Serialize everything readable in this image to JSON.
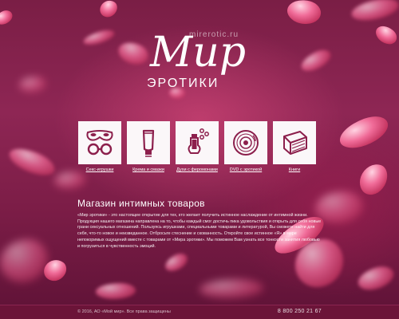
{
  "site": {
    "domain": "mirerotic.ru",
    "logo_main": "Мир",
    "logo_sub": "ЭРОТИКИ"
  },
  "categories": [
    {
      "label": "Секс-игрушки",
      "icon": "handcuffs-mask-icon"
    },
    {
      "label": "Крема и смазки",
      "icon": "cream-tube-icon"
    },
    {
      "label": "Духи с феромонами",
      "icon": "perfume-bottle-icon"
    },
    {
      "label": "DVD с эротикой",
      "icon": "dvd-disc-icon"
    },
    {
      "label": "Книги",
      "icon": "book-icon"
    }
  ],
  "main": {
    "title": "Магазин интимных товаров",
    "description": "«Мир эротики» - это настоящее открытие для тех, кто желает получить истинное наслаждение от интимной жизни. Продукция нашего магазина направлена на то, чтобы каждый смог достичь пика удовольствия и открыть для себя новые грани сексуальных отношений. Пользуясь игрушками, специальными товарами и литературой, Вы сможете найти для себя, что-то новое и неизведанное. Отбросьте стеснение и скованность. Откройте свое истинное «Я» в мире непокоримых ощущений вместе с товарами от «Мира эротики». Мы поможем Вам узнать все тонкости занятия любовью и погрузиться в чувственность эмоций."
  },
  "footer": {
    "copyright": "© 2016, АО «Мой мир». Все права защищены",
    "phone": "8 800 250 21 67"
  },
  "colors": {
    "background": "#8e2654",
    "footer": "#6b1438",
    "icon": "#8c1f4c"
  }
}
